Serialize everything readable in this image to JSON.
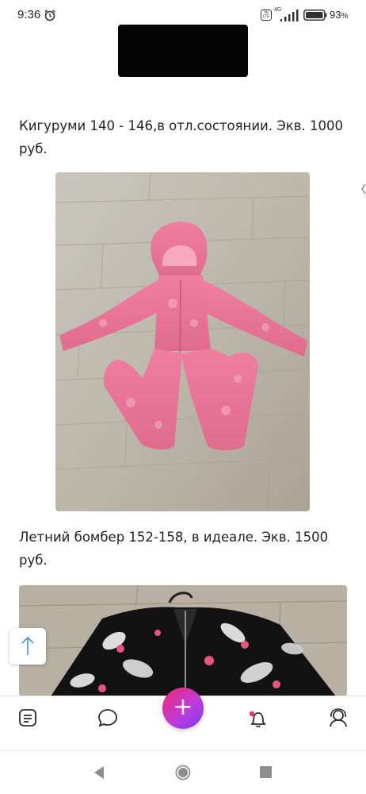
{
  "status_bar": {
    "time": "9:36",
    "network_label": "4G",
    "volte_label": "Vo LTE",
    "battery_percent": "93",
    "battery_percent_sign": "%",
    "icons": [
      "alarm-icon",
      "volte-icon",
      "signal-icon",
      "battery-icon"
    ]
  },
  "feed": {
    "posts": [
      {
        "caption": "Кигуруми 140 - 146,в отл.состоянии. Экв. 1000 руб."
      },
      {
        "caption": "Летний бомбер 152-158, в идеале. Экв. 1500 руб."
      }
    ]
  },
  "scroll_top": {
    "icon": "arrow-up-icon"
  },
  "bottom_nav": {
    "items": [
      {
        "name": "feed",
        "icon": "newsfeed-icon"
      },
      {
        "name": "messages",
        "icon": "chat-bubble-icon"
      },
      {
        "name": "compose",
        "icon": "plus-icon",
        "label": "+"
      },
      {
        "name": "notifications",
        "icon": "bell-icon"
      },
      {
        "name": "friends",
        "icon": "friends-icon"
      }
    ],
    "accent_gradient": [
      "#f0276e",
      "#c03bd9",
      "#7a3cf1"
    ],
    "notification_dot_color": "#e03a6a"
  },
  "system_nav": {
    "icons": [
      "back-triangle-icon",
      "home-circle-icon",
      "recents-square-icon"
    ]
  }
}
